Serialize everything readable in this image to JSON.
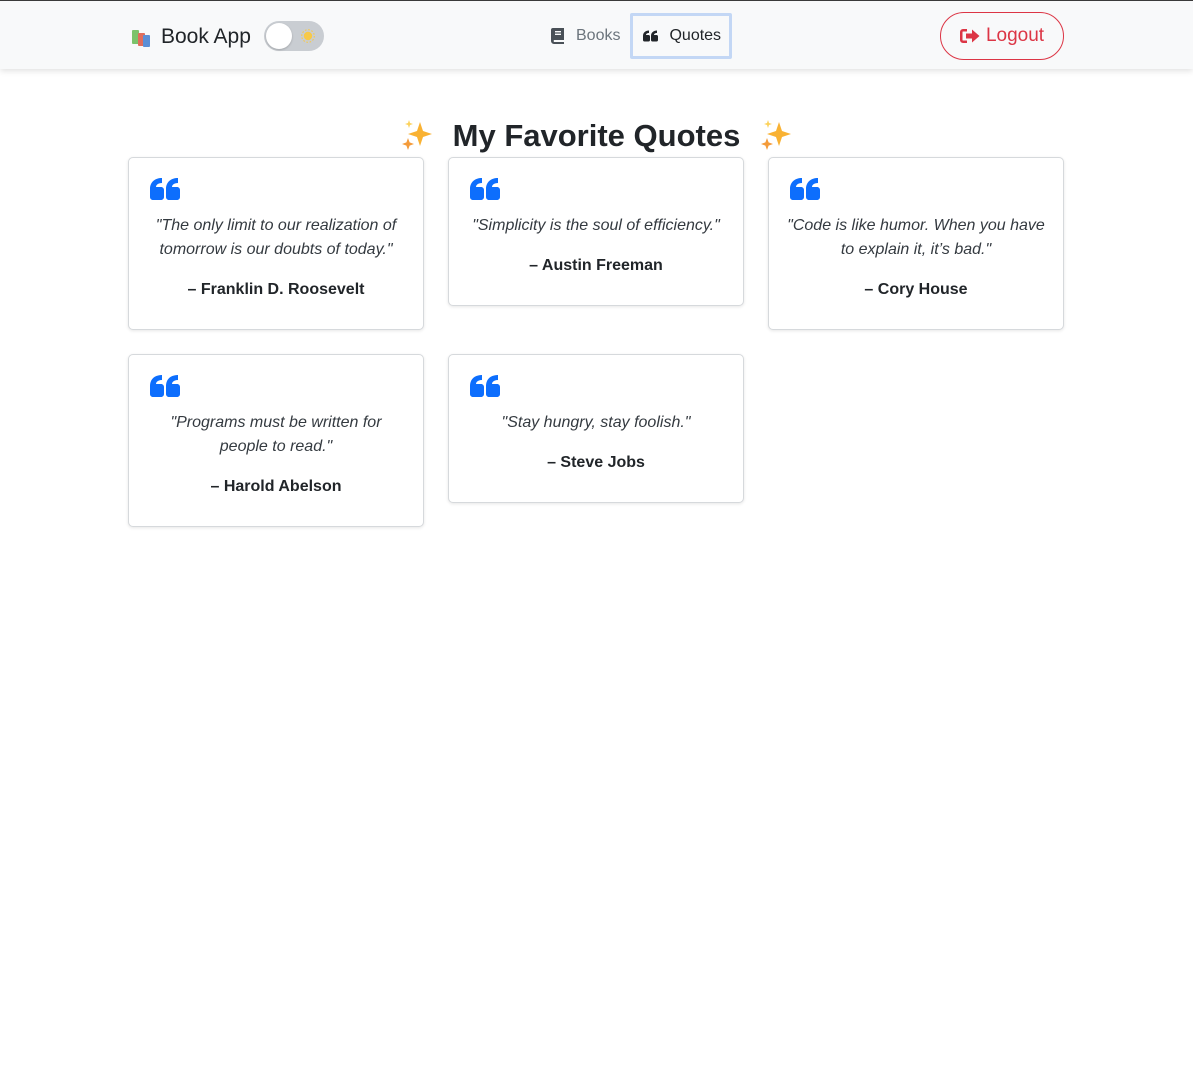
{
  "navbar": {
    "brand_label": "Book App",
    "brand_icon": "books-icon",
    "theme_toggle": {
      "state": "off",
      "icon": "sun-icon"
    },
    "links": [
      {
        "label": "Books",
        "icon": "book-icon",
        "active": false
      },
      {
        "label": "Quotes",
        "icon": "quote-icon",
        "active": true
      }
    ],
    "logout_label": "Logout",
    "logout_icon": "sign-out-icon"
  },
  "page": {
    "title": "My Favorite Quotes",
    "title_icon": "sparkles-icon"
  },
  "quotes": [
    {
      "text": "\"The only limit to our realization of tomorrow is our doubts of today.\"",
      "author": "– Franklin D. Roosevelt"
    },
    {
      "text": "\"Simplicity is the soul of efficiency.\"",
      "author": "– Austin Freeman"
    },
    {
      "text": "\"Code is like humor. When you have to explain it, it’s bad.\"",
      "author": "– Cory House"
    },
    {
      "text": "\"Programs must be written for people to read.\"",
      "author": "– Harold Abelson"
    },
    {
      "text": "\"Stay hungry, stay foolish.\"",
      "author": "– Steve Jobs"
    }
  ],
  "colors": {
    "accent": "#0d6efd",
    "danger": "#dc3545",
    "navbar_bg": "#f8f9fa",
    "active_outline": "#c3d7f5"
  }
}
